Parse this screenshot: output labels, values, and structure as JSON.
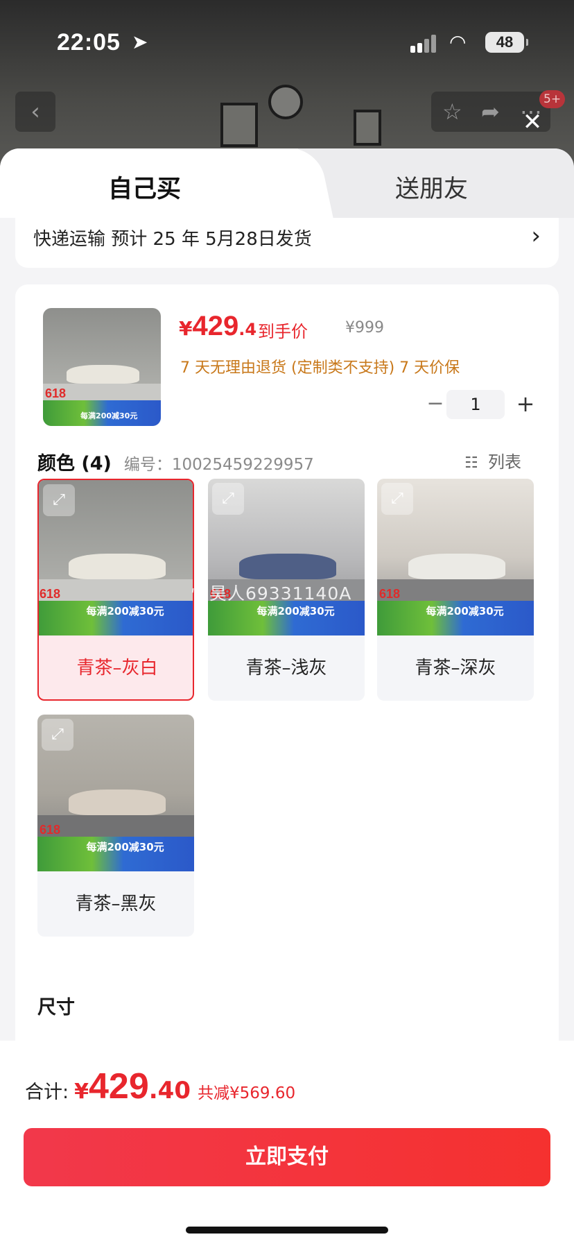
{
  "status_bar": {
    "time": "22:05",
    "battery": "48"
  },
  "background": {
    "back_icon": "‹",
    "badge": "5+"
  },
  "tabs": {
    "self_buy": "自己买",
    "gift": "送朋友"
  },
  "shipping": {
    "text": "快递运输 预计 25 年 5月28日发货"
  },
  "product": {
    "price_yen": "¥",
    "price_int": "429",
    "price_dec": ".4",
    "price_label": "到手价",
    "original_price": "¥999",
    "policy": "7 天无理由退货 (定制类不支持)  7 天价保",
    "quantity": "1",
    "promo_618": "618",
    "promo_text": "每满200减30元"
  },
  "color_section": {
    "title": "颜色 (4)",
    "code": "编号：10025459229957",
    "list_toggle": "列表",
    "options": [
      {
        "name": "青茶–灰白",
        "selected": true
      },
      {
        "name": "青茶–浅灰",
        "selected": false
      },
      {
        "name": "青茶–深灰",
        "selected": false
      },
      {
        "name": "青茶–黑灰",
        "selected": false
      }
    ],
    "watermark": "恺昊人69331140A"
  },
  "size_section": {
    "title": "尺寸"
  },
  "footer": {
    "total_label": "合计:",
    "total_yen": "¥",
    "total_int": "429",
    "total_dec": ".40",
    "saving": "共减¥569.60",
    "pay_button": "立即支付"
  },
  "colors": {
    "accent": "#e8262d",
    "policy": "#c8781a"
  }
}
